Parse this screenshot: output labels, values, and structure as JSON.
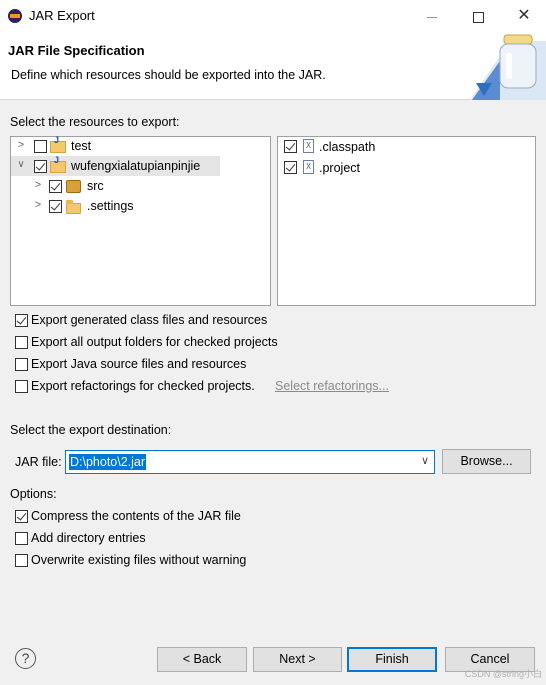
{
  "window": {
    "title": "JAR Export",
    "close_glyph": "✕"
  },
  "banner": {
    "title": "JAR File Specification",
    "description": "Define which resources should be exported into the JAR."
  },
  "resources": {
    "label": "Select the resources to export:",
    "tree": [
      {
        "label": "test",
        "checked": false,
        "expanded": false,
        "icon": "project-icon"
      },
      {
        "label": "wufengxialatupianpinjie",
        "checked": true,
        "expanded": true,
        "selected": true,
        "icon": "java-project-icon"
      },
      {
        "label": "src",
        "checked": true,
        "expanded": false,
        "icon": "package-folder-icon"
      },
      {
        "label": ".settings",
        "checked": true,
        "expanded": false,
        "icon": "folder-icon"
      }
    ],
    "files": [
      {
        "label": ".classpath",
        "checked": true,
        "icon": "xml-file-icon"
      },
      {
        "label": ".project",
        "checked": true,
        "icon": "xml-file-icon"
      }
    ]
  },
  "export_options": [
    {
      "label": "Export generated class files and resources",
      "checked": true
    },
    {
      "label": "Export all output folders for checked projects",
      "checked": false
    },
    {
      "label": "Export Java source files and resources",
      "checked": false
    },
    {
      "label": "Export refactorings for checked projects.",
      "checked": false
    }
  ],
  "select_refactorings_link": "Select refactorings...",
  "destination": {
    "label": "Select the export destination:",
    "jar_file_label": "JAR file:",
    "jar_file_value": "D:\\photo\\2.jar",
    "browse_label": "Browse..."
  },
  "options": {
    "label": "Options:",
    "items": [
      {
        "label": "Compress the contents of the JAR file",
        "checked": true
      },
      {
        "label": "Add directory entries",
        "checked": false
      },
      {
        "label": "Overwrite existing files without warning",
        "checked": false
      }
    ]
  },
  "buttons": {
    "help": "?",
    "back": "< Back",
    "next": "Next >",
    "finish": "Finish",
    "cancel": "Cancel"
  },
  "watermark": "CSDN @string小白",
  "colors": {
    "accent": "#0078d7",
    "selection_bg": "#e5e5e5"
  }
}
